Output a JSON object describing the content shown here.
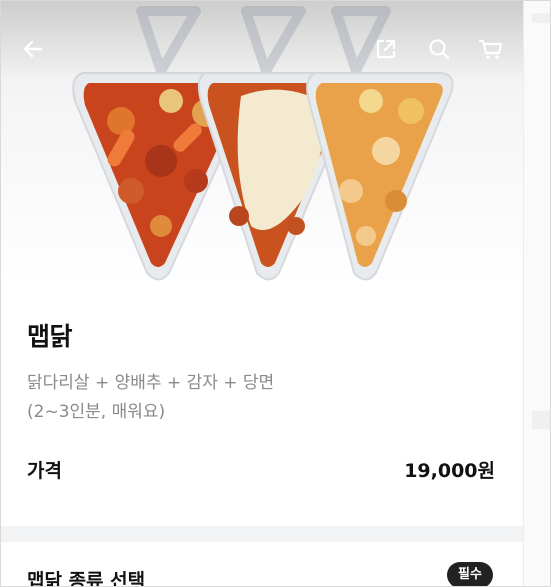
{
  "product": {
    "title": "맵닭",
    "description_line1": "닭다리살 + 양배추 + 감자 + 당면",
    "description_line2": "(2~3인분, 매워요)"
  },
  "price": {
    "label": "가격",
    "value": "19,000원"
  },
  "options": {
    "section_title": "맵닭 종류 선택",
    "required_badge": "필수"
  },
  "icons": {
    "back": "back-arrow-icon",
    "share": "share-icon",
    "search": "search-icon",
    "cart": "cart-icon"
  },
  "colors": {
    "sauce_red": "#c9431c",
    "sauce_cream": "#e9a24a",
    "cheese": "#f3ead0",
    "badge_bg": "#222222"
  }
}
